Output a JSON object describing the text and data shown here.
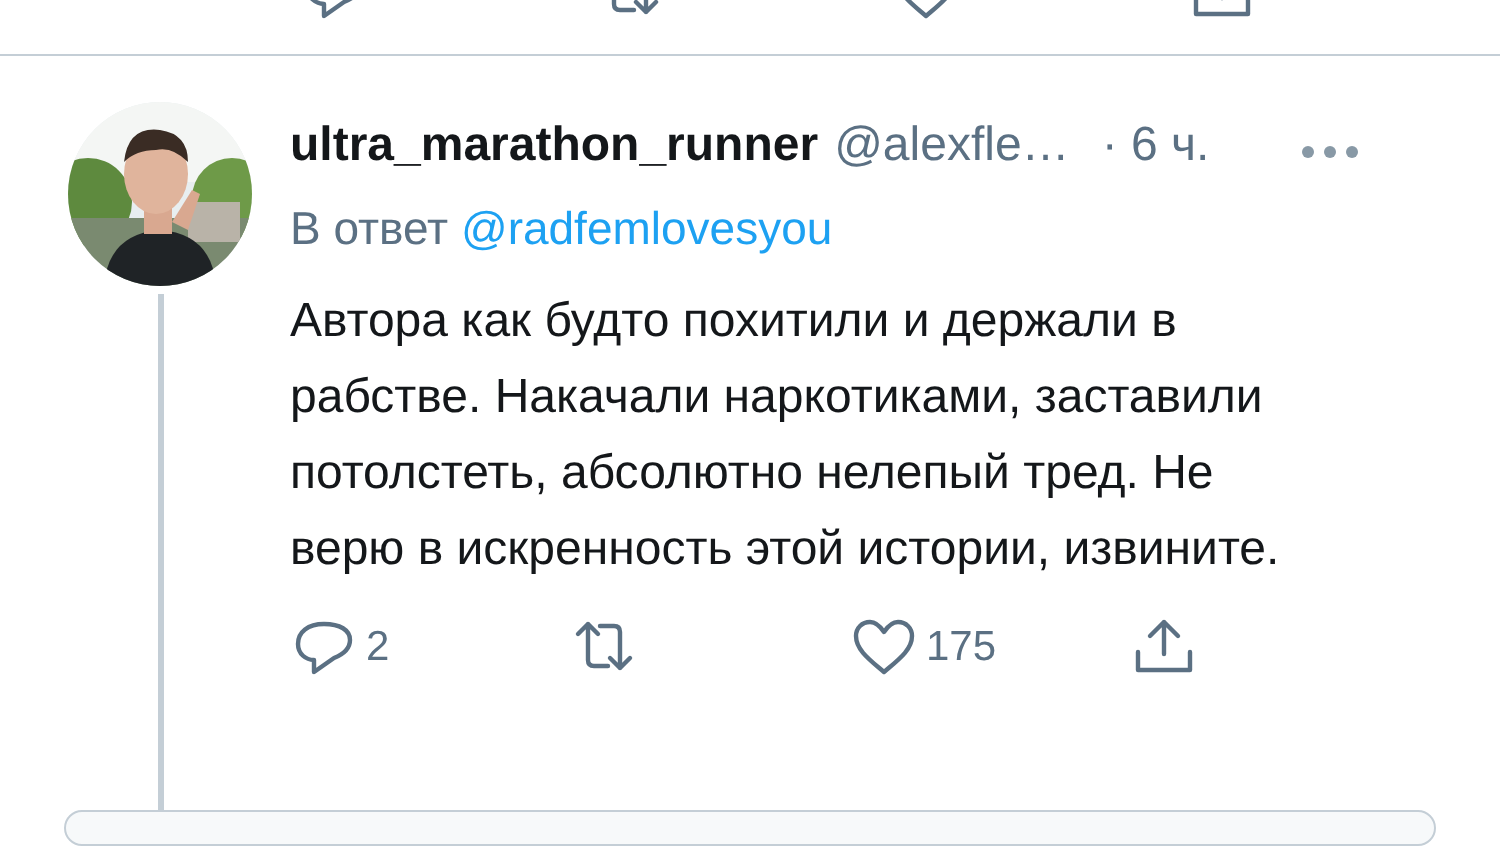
{
  "previous_tweet_actions": [
    {
      "kind": "reply"
    },
    {
      "kind": "retweet"
    },
    {
      "kind": "like"
    },
    {
      "kind": "share"
    }
  ],
  "tweet": {
    "author_name": "ultra_marathon_runner",
    "handle": "@alexfle…",
    "time": "· 6 ч.",
    "reply_prefix": "В ответ",
    "reply_to": "@radfemlovesyou",
    "text": "Автора как будто похитили и держали в рабстве. Накачали наркотиками, заставили потолстеть, абсолютно нелепый тред. Не верю в искренность этой истории, извините.",
    "actions": [
      {
        "kind": "reply",
        "count": "2"
      },
      {
        "kind": "retweet"
      },
      {
        "kind": "like",
        "count": "175"
      },
      {
        "kind": "share"
      }
    ]
  }
}
